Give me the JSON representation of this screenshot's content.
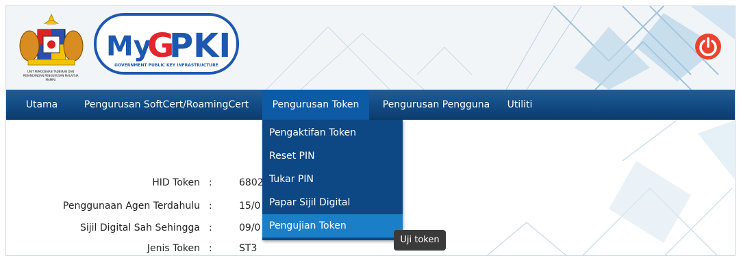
{
  "header": {
    "crest_text": "UNIT PEMODENAN TADBIRAN DAN PERANCANGAN PENGURUSAN MALAYSIA",
    "logo_text": "MyGPKI",
    "logo_subtitle": "GOVERNMENT PUBLIC KEY INFRASTRUCTURE",
    "power_icon": "power-icon",
    "power_color": "#e8442e"
  },
  "nav": {
    "items": [
      {
        "label": "Utama"
      },
      {
        "label": "Pengurusan SoftCert/RoamingCert"
      },
      {
        "label": "Pengurusan Token",
        "active": true
      },
      {
        "label": "Pengurusan Pengguna"
      },
      {
        "label": "Utiliti"
      }
    ],
    "bar_color": "#124a82",
    "active_color": "#0e5ba5"
  },
  "dropdown": {
    "items": [
      {
        "label": "Pengaktifan Token"
      },
      {
        "label": "Reset PIN"
      },
      {
        "label": "Tukar PIN"
      },
      {
        "label": "Papar Sijil Digital"
      },
      {
        "label": "Pengujian Token",
        "hovered": true
      }
    ],
    "bg_color": "#0d4784",
    "hover_color": "#1b7fc8"
  },
  "token_info": {
    "rows": [
      {
        "label": "HID Token",
        "separator": ":",
        "value": "6802"
      },
      {
        "label": "Penggunaan Agen Terdahulu",
        "separator": ":",
        "value": "15/0"
      },
      {
        "label": "Sijil Digital Sah Sehingga",
        "separator": ":",
        "value": "09/0"
      },
      {
        "label": "Jenis Token",
        "separator": ":",
        "value": "ST3"
      }
    ]
  },
  "tooltip": {
    "text": "Uji token"
  }
}
